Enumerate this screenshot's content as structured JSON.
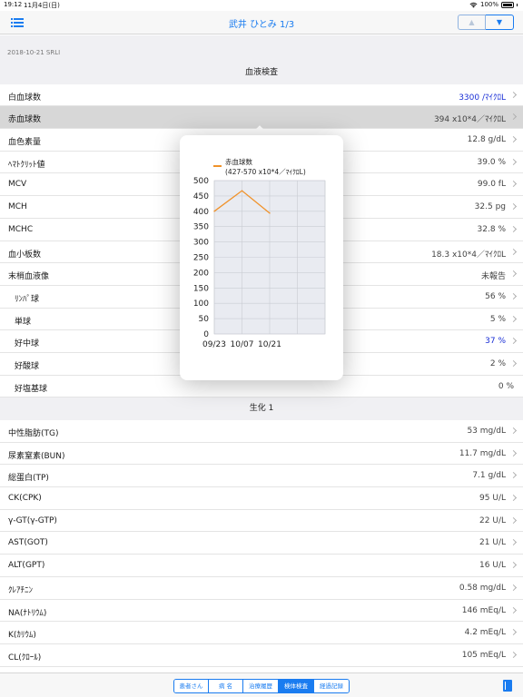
{
  "status_bar": {
    "time": "19:12",
    "date": "11月4日(日)",
    "battery": "100%"
  },
  "nav": {
    "title": "武井 ひとみ 1/3",
    "up_label": "▲",
    "down_label": "▼"
  },
  "subheader": "2018-10-21 SRLI",
  "sections": {
    "blood": {
      "title": "血液検査",
      "rows": [
        {
          "name": "白血球数",
          "value": "3300 /ﾏｲｸﾛL",
          "highlight": true
        },
        {
          "name": "赤血球数",
          "value": "394 x10*4／ﾏｲｸﾛL"
        },
        {
          "name": "血色素量",
          "value": "12.8 g/dL"
        },
        {
          "name": "ﾍﾏﾄｸﾘｯﾄ値",
          "value": "39.0 %"
        },
        {
          "name": "MCV",
          "value": "99.0 fL"
        },
        {
          "name": "MCH",
          "value": "32.5 pg"
        },
        {
          "name": "MCHC",
          "value": "32.8 %"
        },
        {
          "name": "血小板数",
          "value": "18.3 x10*4／ﾏｲｸﾛL"
        },
        {
          "name": "末梢血液像",
          "value": "未報告"
        },
        {
          "name": "ﾘﾝﾊﾟ球",
          "value": "56 %"
        },
        {
          "name": "単球",
          "value": "5 %"
        },
        {
          "name": "好中球",
          "value": "37 %",
          "highlight": true
        },
        {
          "name": "好酸球",
          "value": "2 %"
        },
        {
          "name": "好塩基球",
          "value": "0 %"
        }
      ]
    },
    "chem": {
      "title": "生化 1",
      "rows": [
        {
          "name": "中性脂肪(TG)",
          "value": "53 mg/dL"
        },
        {
          "name": "尿素窒素(BUN)",
          "value": "11.7 mg/dL"
        },
        {
          "name": "総蛋白(TP)",
          "value": "7.1 g/dL"
        },
        {
          "name": "CK(CPK)",
          "value": "95 U/L"
        },
        {
          "name": "γ-GT(γ-GTP)",
          "value": "22 U/L"
        },
        {
          "name": "AST(GOT)",
          "value": "21 U/L"
        },
        {
          "name": "ALT(GPT)",
          "value": "16 U/L"
        },
        {
          "name": "ｸﾚｱﾁﾆﾝ",
          "value": "0.58 mg/dL"
        },
        {
          "name": "NA(ﾅﾄﾘｳﾑ)",
          "value": "146 mEq/L"
        },
        {
          "name": "K(ｶﾘｳﾑ)",
          "value": "4.2 mEq/L"
        },
        {
          "name": "CL(ｸﾛｰﾙ)",
          "value": "105 mEq/L"
        }
      ]
    }
  },
  "popover": {
    "legend_title": "赤血球数",
    "legend_range": "(427-570 x10*4／ﾏｲｸﾛL)"
  },
  "chart_data": {
    "type": "line",
    "series": [
      {
        "name": "赤血球数",
        "x": [
          "09/23",
          "10/07",
          "10/21"
        ],
        "values": [
          400,
          467,
          394
        ],
        "color": "#f0922a"
      }
    ],
    "x_ticks": [
      "09/23",
      "10/07",
      "10/21"
    ],
    "y_ticks": [
      "0",
      "50",
      "100",
      "150",
      "200",
      "250",
      "300",
      "350",
      "400",
      "450",
      "500"
    ],
    "ylim": [
      0,
      500
    ],
    "grid": true
  },
  "tabbar": {
    "tabs": [
      {
        "label": "患者さん"
      },
      {
        "label": "病 名"
      },
      {
        "label": "治療履歴"
      },
      {
        "label": "検体検査",
        "active": true
      },
      {
        "label": "経過記録"
      }
    ]
  }
}
